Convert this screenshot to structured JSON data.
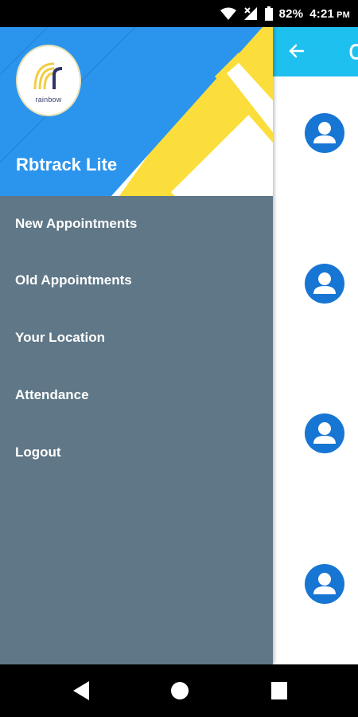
{
  "status_bar": {
    "battery_text": "82%",
    "time": "4:21",
    "ampm": "PM"
  },
  "drawer": {
    "logo_text": "rainbow",
    "app_name": "Rbtrack Lite",
    "menu": [
      {
        "label": "New Appointments"
      },
      {
        "label": "Old Appointments"
      },
      {
        "label": "Your Location"
      },
      {
        "label": "Attendance"
      },
      {
        "label": "Logout"
      }
    ]
  },
  "background_app": {
    "toolbar_color": "#1ec0ef",
    "avatar_color": "#1776d3",
    "list_items": [
      {
        "icon": "person-icon"
      },
      {
        "icon": "person-icon"
      },
      {
        "icon": "person-icon"
      },
      {
        "icon": "person-icon"
      }
    ]
  },
  "colors": {
    "drawer_bg": "#5f7786",
    "header_blue": "#2b95ee",
    "accent_yellow": "#fbde3b"
  }
}
